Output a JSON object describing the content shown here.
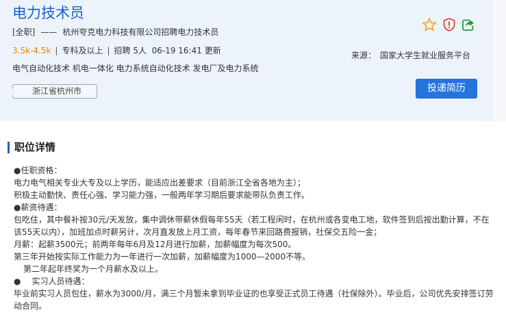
{
  "job": {
    "title": "电力技术员",
    "type": "[全职]",
    "dash": "——",
    "company_line": "杭州夸克电力科技有限公司招聘电力技术员",
    "salary": "3.5k-4.5k",
    "separator": "|",
    "education": "专科及以上",
    "headcount": "招聘 5人",
    "updated": "06-19 16:41 更新",
    "tags": "电气自动化技术 机电一体化 电力系统自动化技术 发电厂及电力系统",
    "location": "浙江省杭州市"
  },
  "source": {
    "label": "来源：",
    "name": "国家大学生就业服务平台"
  },
  "actions": {
    "apply_label": "投递简历",
    "favorite_icon": "star-outline-icon",
    "report_icon": "warning-shield-icon",
    "share_icon": "share-arrow-icon"
  },
  "colors": {
    "brand_blue": "#1a61c8",
    "button_blue": "#2474dc",
    "salary_orange": "#f08000",
    "star_orange": "#f0a020",
    "alert_red": "#e03030",
    "share_green": "#2a9a3a",
    "header_bg": "#edf3fb"
  },
  "details": {
    "section_title": "职位详情",
    "lines": [
      "●任职资格：",
      "电力电气相关专业大专及以上学历，能适应出差要求（目前浙江全省各地为主）；",
      "积极主动勤快、责任心强、学习能力强，一般两年学习期后要求能带队负责工作。",
      "●薪资待遇：",
      "包吃住，其中餐补按30元/天发放，集中调休带薪休假每年55天（若工程闲时，在杭州或各变电工地，软件签到后按出勤计算，不在该55天以内），加班加点时薪另计，次月直发放上月工资，每年春节来回路费报销，社保交五险一金；",
      "月薪：起薪3500元；前两年每年6月及12月进行加薪，加薪幅度为每次500。",
      "第三年开始按实际工作能力为一年进行一次加薪，加薪幅度为1000—2000不等。",
      "第二年起年终奖为一个月薪水及以上。",
      "●",
      "实习人员待遇：",
      "毕业前实习人员包住，薪水为3000/月，满三个月暂未拿到毕业证的也享受正式员工待遇（社保除外）。毕业后，公司优先安排签订劳动合同。"
    ]
  }
}
